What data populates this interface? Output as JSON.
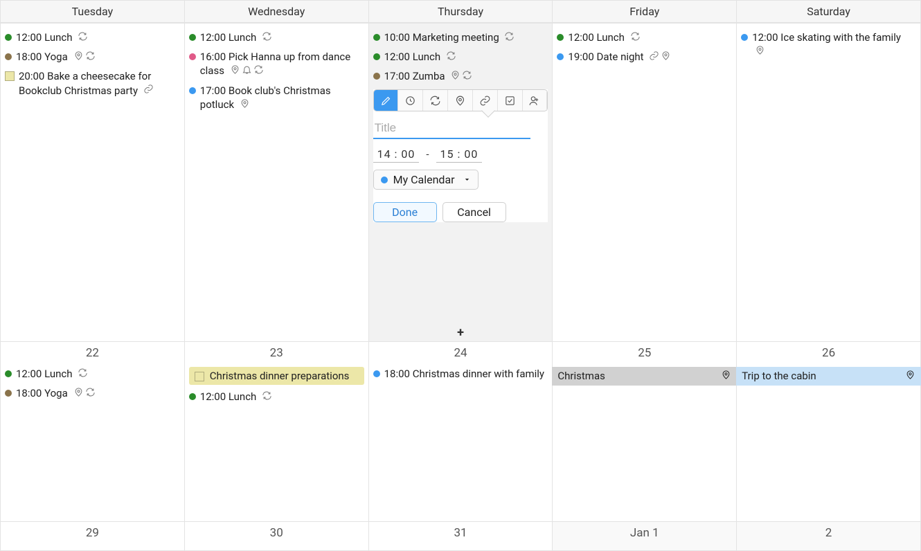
{
  "colors": {
    "green": "#2a8c2a",
    "brown": "#8a734b",
    "blue": "#3b99f0",
    "pink": "#e05a88"
  },
  "headers": [
    "Tuesday",
    "Wednesday",
    "Thursday",
    "Friday",
    "Saturday"
  ],
  "rows": [
    {
      "cells": [
        {
          "selected": false,
          "events": [
            {
              "type": "dot",
              "color": "green",
              "time": "12:00",
              "title": "Lunch",
              "icons": [
                "repeat"
              ]
            },
            {
              "type": "dot",
              "color": "brown",
              "time": "18:00",
              "title": "Yoga",
              "icons": [
                "location",
                "repeat"
              ]
            },
            {
              "type": "square",
              "color": "#ece7a8",
              "time": "20:00",
              "title": "Bake a cheesecake for Bookclub Christmas party",
              "icons": [
                "link"
              ]
            }
          ]
        },
        {
          "selected": false,
          "events": [
            {
              "type": "dot",
              "color": "green",
              "time": "12:00",
              "title": "Lunch",
              "icons": [
                "repeat"
              ]
            },
            {
              "type": "dot",
              "color": "pink",
              "time": "16:00",
              "title": "Pick Hanna up from dance class",
              "icons": [
                "location",
                "bell",
                "repeat"
              ]
            },
            {
              "type": "dot",
              "color": "blue",
              "time": "17:00",
              "title": "Book club's Christmas potluck",
              "icons": [
                "location"
              ]
            }
          ]
        },
        {
          "selected": true,
          "events": [
            {
              "type": "dot",
              "color": "green",
              "time": "10:00",
              "title": "Marketing meeting",
              "icons": [
                "repeat"
              ]
            },
            {
              "type": "dot",
              "color": "green",
              "time": "12:00",
              "title": "Lunch",
              "icons": [
                "repeat"
              ]
            },
            {
              "type": "dot",
              "color": "brown",
              "time": "17:00",
              "title": "Zumba",
              "icons": [
                "location",
                "repeat"
              ]
            }
          ],
          "popover": {
            "title_placeholder": "Title",
            "start_time": "14 : 00",
            "dash": "-",
            "end_time": "15 : 00",
            "calendar_label": "My Calendar",
            "done_label": "Done",
            "cancel_label": "Cancel"
          },
          "add_btn": "+"
        },
        {
          "selected": false,
          "events": [
            {
              "type": "dot",
              "color": "green",
              "time": "12:00",
              "title": "Lunch",
              "icons": [
                "repeat"
              ]
            },
            {
              "type": "dot",
              "color": "blue",
              "time": "19:00",
              "title": "Date night",
              "icons": [
                "link",
                "location"
              ]
            }
          ]
        },
        {
          "selected": false,
          "events": [
            {
              "type": "dot",
              "color": "blue",
              "time": "12:00",
              "title": "Ice skating with the family",
              "icons": [
                "location"
              ]
            }
          ]
        }
      ]
    },
    {
      "cells": [
        {
          "day": "22",
          "events": [
            {
              "type": "dot",
              "color": "green",
              "time": "12:00",
              "title": "Lunch",
              "icons": [
                "repeat"
              ]
            },
            {
              "type": "dot",
              "color": "brown",
              "time": "18:00",
              "title": "Yoga",
              "icons": [
                "location",
                "repeat"
              ]
            }
          ]
        },
        {
          "day": "23",
          "events": [
            {
              "type": "banner",
              "banner_color": "yellow",
              "square_color": "#ece7a8",
              "title": "Christmas dinner preparations"
            },
            {
              "type": "dot",
              "color": "green",
              "time": "12:00",
              "title": "Lunch",
              "icons": [
                "repeat"
              ]
            }
          ]
        },
        {
          "day": "24",
          "events": [
            {
              "type": "dot",
              "color": "blue",
              "time": "18:00",
              "title": "Christmas dinner with family",
              "icons": []
            }
          ]
        },
        {
          "day": "25",
          "events": [
            {
              "type": "banner",
              "banner_color": "grey",
              "title": "Christmas",
              "icons": [
                "location"
              ],
              "extend": true
            }
          ]
        },
        {
          "day": "26",
          "events": [
            {
              "type": "banner",
              "banner_color": "blue",
              "title": "Trip to the cabin",
              "icons": [
                "location"
              ],
              "extend": true
            }
          ]
        }
      ]
    },
    {
      "cells": [
        {
          "day": "29"
        },
        {
          "day": "30"
        },
        {
          "day": "31"
        },
        {
          "day": "Jan  1",
          "other_month": true
        },
        {
          "day": "2",
          "other_month": true
        }
      ]
    }
  ]
}
